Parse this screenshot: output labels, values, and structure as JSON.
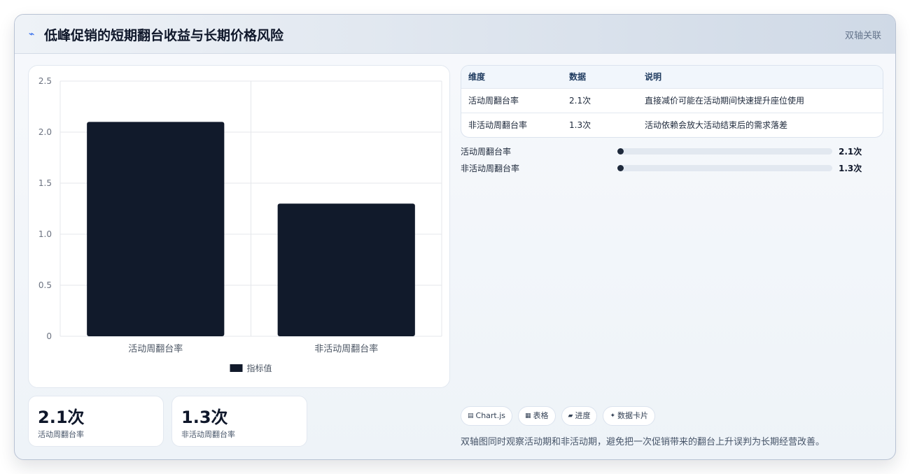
{
  "header": {
    "icon": "lightning-icon",
    "title": "低峰促销的短期翻台收益与长期价格风险",
    "tag": "双轴关联"
  },
  "chart_data": {
    "type": "bar",
    "categories": [
      "活动周翻台率",
      "非活动周翻台率"
    ],
    "series": [
      {
        "name": "指标值",
        "values": [
          2.1,
          1.3
        ],
        "color": "#111a2b"
      }
    ],
    "ylim": [
      0,
      2.5
    ],
    "yticks": [
      "0",
      "0.5",
      "1.0",
      "1.5",
      "2.0",
      "2.5"
    ],
    "grid": true,
    "legend": "bottom"
  },
  "stats": [
    {
      "value": "2.1次",
      "label": "活动周翻台率"
    },
    {
      "value": "1.3次",
      "label": "非活动周翻台率"
    }
  ],
  "table": {
    "headers": [
      "维度",
      "数据",
      "说明"
    ],
    "rows": [
      [
        "活动周翻台率",
        "2.1次",
        "直接减价可能在活动期间快速提升座位使用"
      ],
      [
        "非活动周翻台率",
        "1.3次",
        "活动依赖会放大活动结束后的需求落差"
      ]
    ]
  },
  "progress": [
    {
      "label": "活动周翻台率",
      "value": "2.1次",
      "fraction": 0
    },
    {
      "label": "非活动周翻台率",
      "value": "1.3次",
      "fraction": 0
    }
  ],
  "chips": [
    {
      "icon": "chart-icon",
      "glyph": "▤",
      "label": "Chart.js"
    },
    {
      "icon": "table-icon",
      "glyph": "▦",
      "label": "表格"
    },
    {
      "icon": "progress-icon",
      "glyph": "▰",
      "label": "进度"
    },
    {
      "icon": "sparkle-icon",
      "glyph": "✦",
      "label": "数据卡片"
    }
  ],
  "note": "双轴图同时观察活动期和非活动期，避免把一次促销带来的翻台上升误判为长期经营改善。",
  "colors": {
    "accent": "#2563eb",
    "bar": "#111a2b",
    "dark": "#0f172a"
  }
}
